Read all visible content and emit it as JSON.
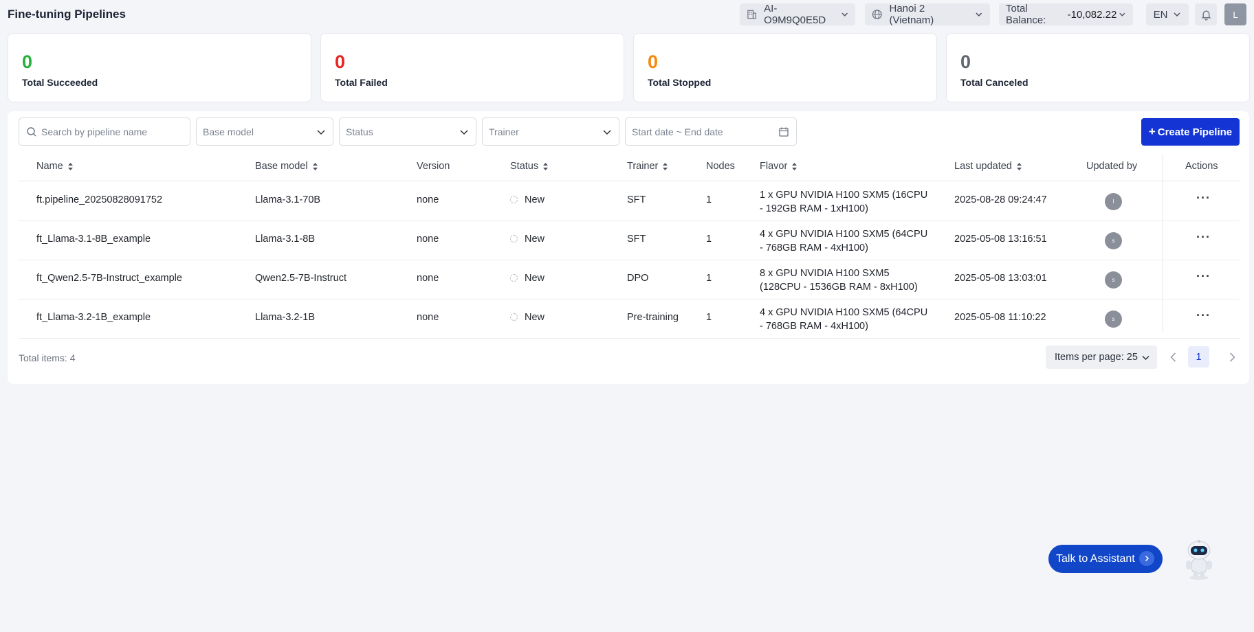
{
  "header": {
    "title": "Fine-tuning Pipelines",
    "project": "AI-O9M9Q0E5D",
    "region": "Hanoi 2 (Vietnam)",
    "balance_label": "Total Balance:",
    "balance_value": "-10,082.22 ₫",
    "language": "EN",
    "user_initial": "L"
  },
  "stats": [
    {
      "value": "0",
      "label": "Total Succeeded",
      "color": "#25b03a"
    },
    {
      "value": "0",
      "label": "Total Failed",
      "color": "#e8241f"
    },
    {
      "value": "0",
      "label": "Total Stopped",
      "color": "#f5890f"
    },
    {
      "value": "0",
      "label": "Total Canceled",
      "color": "#5f6670"
    }
  ],
  "filters": {
    "search_placeholder": "Search by pipeline name",
    "base_model": "Base model",
    "status": "Status",
    "trainer": "Trainer",
    "date_range": "Start date ~ End date",
    "create_button": "Create Pipeline"
  },
  "table": {
    "columns": {
      "name": "Name",
      "base_model": "Base model",
      "version": "Version",
      "status": "Status",
      "trainer": "Trainer",
      "nodes": "Nodes",
      "flavor": "Flavor",
      "last_updated": "Last updated",
      "updated_by": "Updated by",
      "actions": "Actions"
    },
    "rows": [
      {
        "name": "ft.pipeline_20250828091752",
        "base_model": "Llama-3.1-70B",
        "version": "none",
        "status": "New",
        "trainer": "SFT",
        "nodes": "1",
        "flavor": "1 x GPU NVIDIA H100 SXM5 (16CPU - 192GB RAM - 1xH100)",
        "last_updated": "2025-08-28 09:24:47",
        "updated_by": "l"
      },
      {
        "name": "ft_Llama-3.1-8B_example",
        "base_model": "Llama-3.1-8B",
        "version": "none",
        "status": "New",
        "trainer": "SFT",
        "nodes": "1",
        "flavor": "4 x GPU NVIDIA H100 SXM5 (64CPU - 768GB RAM - 4xH100)",
        "last_updated": "2025-05-08 13:16:51",
        "updated_by": "s"
      },
      {
        "name": "ft_Qwen2.5-7B-Instruct_example",
        "base_model": "Qwen2.5-7B-Instruct",
        "version": "none",
        "status": "New",
        "trainer": "DPO",
        "nodes": "1",
        "flavor": "8 x GPU NVIDIA H100 SXM5 (128CPU - 1536GB RAM - 8xH100)",
        "last_updated": "2025-05-08 13:03:01",
        "updated_by": "s"
      },
      {
        "name": "ft_Llama-3.2-1B_example",
        "base_model": "Llama-3.2-1B",
        "version": "none",
        "status": "New",
        "trainer": "Pre-training",
        "nodes": "1",
        "flavor": "4 x GPU NVIDIA H100 SXM5 (64CPU - 768GB RAM - 4xH100)",
        "last_updated": "2025-05-08 11:10:22",
        "updated_by": "s"
      }
    ]
  },
  "footer": {
    "total_items": "Total items: 4",
    "items_per_page": "Items per page: 25",
    "current_page": "1"
  },
  "assistant": {
    "label": "Talk to Assistant"
  },
  "colors": {
    "accent": "#1435d4"
  }
}
